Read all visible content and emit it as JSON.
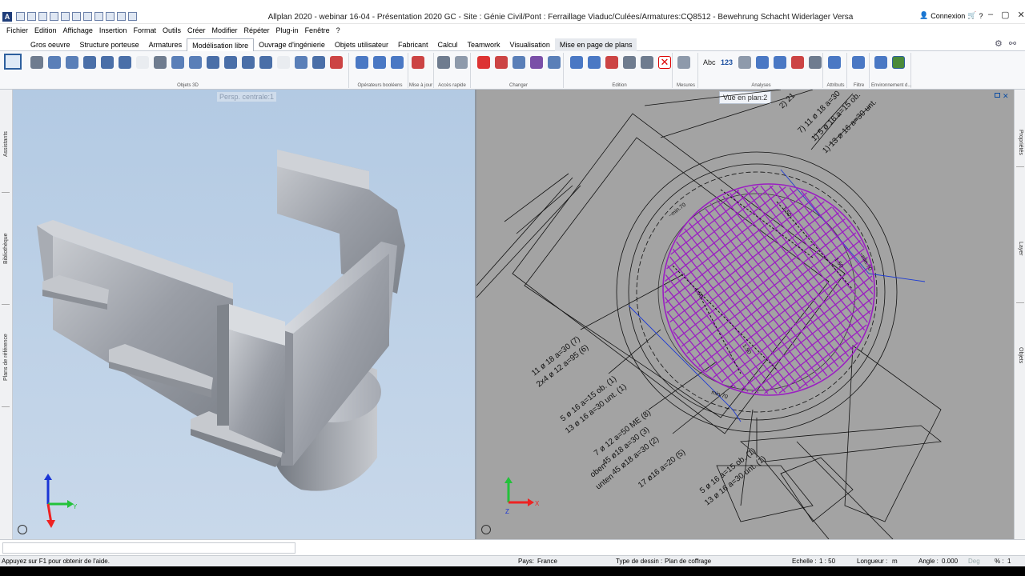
{
  "titlebar": {
    "app_logo": "A",
    "title": "Allplan 2020 - webinar 16-04 - Présentation 2020 GC - Site : Génie Civil/Pont : Ferraillage Viaduc/Culées/Armatures:CQ8512 - Bewehrung Schacht Widerlager Versa",
    "connexion": "Connexion",
    "cart_icon": "cart-icon",
    "help_icon": "help-icon"
  },
  "menu": [
    "Fichier",
    "Edition",
    "Affichage",
    "Insertion",
    "Format",
    "Outils",
    "Créer",
    "Modifier",
    "Répéter",
    "Plug-in",
    "Fenêtre",
    "?"
  ],
  "tabs": [
    {
      "label": "Gros oeuvre"
    },
    {
      "label": "Structure porteuse"
    },
    {
      "label": "Armatures"
    },
    {
      "label": "Modélisation libre",
      "active": true
    },
    {
      "label": "Ouvrage d'ingénierie"
    },
    {
      "label": "Objets utilisateur"
    },
    {
      "label": "Fabricant"
    },
    {
      "label": "Calcul"
    },
    {
      "label": "Teamwork"
    },
    {
      "label": "Visualisation"
    },
    {
      "label": "Mise en page de plans",
      "selected": true
    }
  ],
  "ribbon_groups": [
    {
      "label": "Objets 3D"
    },
    {
      "label": "Opérateurs booléens"
    },
    {
      "label": "Mise à jour"
    },
    {
      "label": "Accès rapide"
    },
    {
      "label": "Changer"
    },
    {
      "label": "Edition"
    },
    {
      "label": "Mesures"
    },
    {
      "label": "Analyses"
    },
    {
      "label": "Attributs"
    },
    {
      "label": "Filtre"
    },
    {
      "label": "Environnement d..."
    }
  ],
  "ribbon_text_icons": {
    "abc": "Abc",
    "num": "123"
  },
  "left_panels": [
    "Assistants",
    "Bibliothèque",
    "Plans de référence"
  ],
  "right_panels": [
    "Propriétés",
    "Layer",
    "Objets"
  ],
  "viewports": {
    "left": {
      "label": "Persp. centrale:1"
    },
    "right": {
      "label": "Vue en plan:2",
      "close": "✕"
    }
  },
  "axes": {
    "x": "X",
    "y": "Y",
    "z": "Z"
  },
  "plan_annotations": {
    "top": [
      "2) 21",
      "7) 11 ø 18 a=30",
      "1) 5 ø 16 a=15 ob.",
      "1) 13 ø 16 a=30 unt."
    ],
    "left": [
      "11 ø 18 a=30 (7)",
      "2x4 ø 12 a=95 (6)"
    ],
    "mid": [
      "5 ø 16 a=15 ob. (1)",
      "13 ø 16 a=30 unt. (1)"
    ],
    "lower": [
      "7 ø 12 a=50 ME (8)",
      "45 ø18 a=30 (3)",
      "45 ø18 a=30 (2)",
      "17 ø16 a=20 (5)"
    ],
    "side": [
      "oben",
      "unten"
    ],
    "bottom": [
      "5 ø 16 a=15 ob. (1)",
      "13 ø 16 a=30 unt. (1)"
    ],
    "dims": [
      "~min.70",
      "1.50",
      "1.50",
      "1.50",
      "1.50",
      "~min.70",
      "min.70"
    ]
  },
  "statusbar": {
    "help": "Appuyez sur F1 pour obtenir de l'aide.",
    "pays_label": "Pays:",
    "pays": "France",
    "type_label": "Type de dessin :",
    "type": "Plan de coffrage",
    "echelle_label": "Echelle :",
    "echelle": "1 : 50",
    "longueur_label": "Longueur :",
    "longueur": "m",
    "angle_label": "Angle :",
    "angle": "0.000",
    "deg": "Deg",
    "pct_label": "% :",
    "pct": "1"
  },
  "colors": {
    "rebar": "#9b1fc2",
    "plan_bg": "#a3a3a3",
    "sky": "#b3cae3"
  }
}
